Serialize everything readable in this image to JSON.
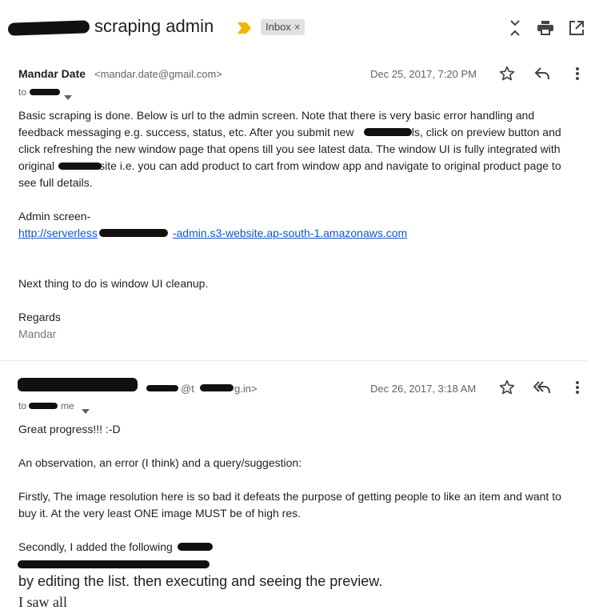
{
  "subject": "scraping admin",
  "label_chip": "Inbox",
  "label_chip_close": "×",
  "messages": [
    {
      "sender": "Mandar Date",
      "email": "<mandar.date@gmail.com>",
      "date": "Dec 25, 2017, 7:20 PM",
      "to": "to",
      "body": {
        "line1": "Basic scraping is done. Below is url to the admin screen. Note that there is very basic error handling and",
        "line2": "feedback messaging e.g. success, status, etc. After you submit new",
        "line2b": "urls, click on preview button and",
        "line3": "click refreshing the new window page that opens till you see latest data. The window UI is fully integrated with",
        "line4a": "original",
        "line4b": "site i.e. you can add product to cart from window app and navigate to original product page to",
        "line5": "see full details.",
        "admin_label": "Admin screen-",
        "link_a": "http://serverless",
        "link_b": "-admin.s3-website.ap-south-1.amazonaws.com",
        "next": "Next thing to do is window UI cleanup.",
        "regards": "Regards",
        "signature": "Mandar"
      }
    },
    {
      "email_tail": "@t",
      "email_end": "g.in>",
      "date": "Dec 26, 2017, 3:18 AM",
      "to": "to",
      "to_me": "me",
      "body": {
        "line1": "Great progress!!! :-D",
        "line2": "An observation, an error (I think) and a query/suggestion:",
        "line3": "Firstly, The image resolution here is so bad it defeats the purpose of getting people to like an item and want to",
        "line4": "buy it. At the very least ONE image MUST be of high res.",
        "line5": "Secondly, I added the following",
        "line6": "by editing the list. then executing and seeing the preview.",
        "line7": "I saw all"
      }
    }
  ]
}
